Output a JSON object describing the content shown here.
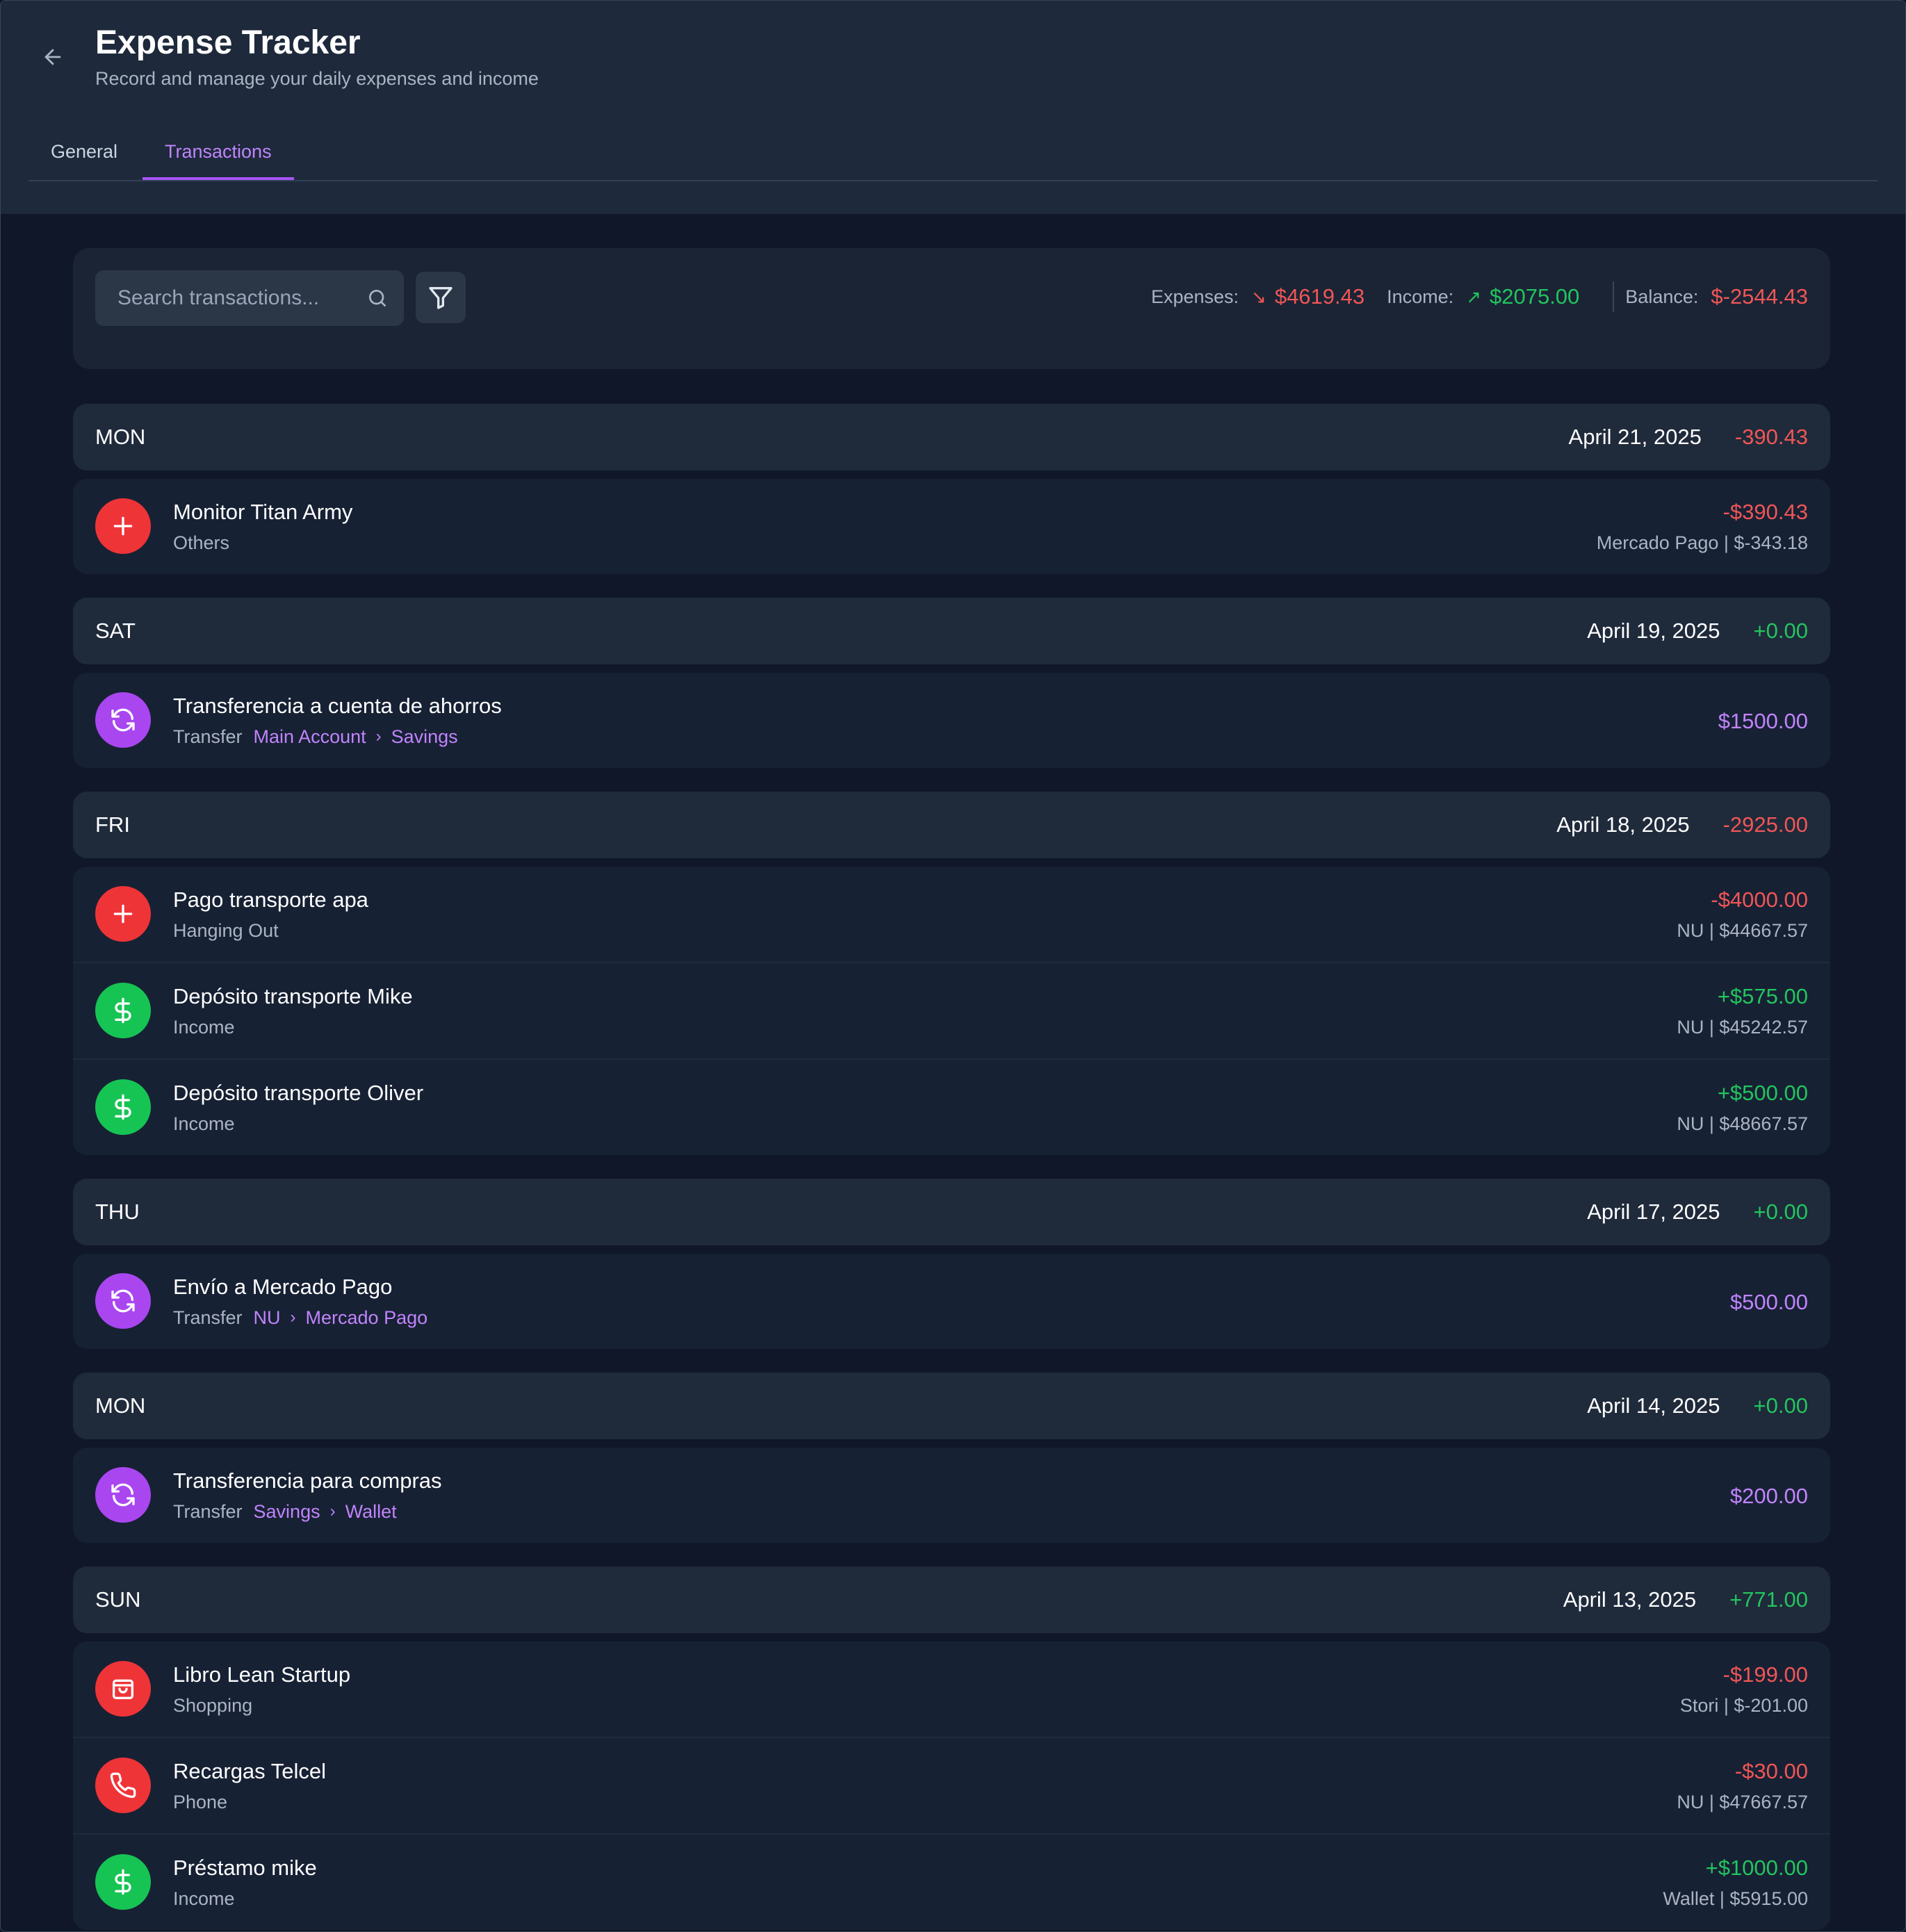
{
  "header": {
    "title": "Expense Tracker",
    "subtitle": "Record and manage your daily expenses and income",
    "tabs": [
      {
        "label": "General",
        "active": false
      },
      {
        "label": "Transactions",
        "active": true
      }
    ]
  },
  "toolbar": {
    "search_placeholder": "Search transactions...",
    "expenses_label": "Expenses:",
    "expenses_value": "$4619.43",
    "income_label": "Income:",
    "income_value": "$2075.00",
    "balance_label": "Balance:",
    "balance_value": "$-2544.43"
  },
  "colors": {
    "expense": "#f05656",
    "income": "#22c55e",
    "transfer": "#c084fc",
    "accent": "#a855f7"
  },
  "groups": [
    {
      "day": "MON",
      "date": "April 21, 2025",
      "total": "-390.43",
      "total_kind": "expense",
      "transactions": [
        {
          "name": "Monitor Titan Army",
          "category": "Others",
          "kind": "expense",
          "icon": "plus-icon",
          "amount": "-$390.43",
          "account": "Mercado Pago | $-343.18"
        }
      ]
    },
    {
      "day": "SAT",
      "date": "April 19, 2025",
      "total": "+0.00",
      "total_kind": "income",
      "transactions": [
        {
          "name": "Transferencia a cuenta de ahorros",
          "category": "Transfer",
          "kind": "transfer",
          "icon": "refresh-icon",
          "amount": "$1500.00",
          "from": "Main Account",
          "to": "Savings"
        }
      ]
    },
    {
      "day": "FRI",
      "date": "April 18, 2025",
      "total": "-2925.00",
      "total_kind": "expense",
      "transactions": [
        {
          "name": "Pago transporte apa",
          "category": "Hanging Out",
          "kind": "expense",
          "icon": "plus-icon",
          "amount": "-$4000.00",
          "account": "NU | $44667.57"
        },
        {
          "name": "Depósito transporte Mike",
          "category": "Income",
          "kind": "income",
          "icon": "dollar-icon",
          "amount": "+$575.00",
          "account": "NU | $45242.57"
        },
        {
          "name": "Depósito transporte Oliver",
          "category": "Income",
          "kind": "income",
          "icon": "dollar-icon",
          "amount": "+$500.00",
          "account": "NU | $48667.57"
        }
      ]
    },
    {
      "day": "THU",
      "date": "April 17, 2025",
      "total": "+0.00",
      "total_kind": "income",
      "transactions": [
        {
          "name": "Envío a Mercado Pago",
          "category": "Transfer",
          "kind": "transfer",
          "icon": "refresh-icon",
          "amount": "$500.00",
          "from": "NU",
          "to": "Mercado Pago"
        }
      ]
    },
    {
      "day": "MON",
      "date": "April 14, 2025",
      "total": "+0.00",
      "total_kind": "income",
      "transactions": [
        {
          "name": "Transferencia para compras",
          "category": "Transfer",
          "kind": "transfer",
          "icon": "refresh-icon",
          "amount": "$200.00",
          "from": "Savings",
          "to": "Wallet"
        }
      ]
    },
    {
      "day": "SUN",
      "date": "April 13, 2025",
      "total": "+771.00",
      "total_kind": "income",
      "transactions": [
        {
          "name": "Libro Lean Startup",
          "category": "Shopping",
          "kind": "expense",
          "icon": "shopping-bag-icon",
          "amount": "-$199.00",
          "account": "Stori | $-201.00"
        },
        {
          "name": "Recargas Telcel",
          "category": "Phone",
          "kind": "expense",
          "icon": "phone-icon",
          "amount": "-$30.00",
          "account": "NU | $47667.57"
        },
        {
          "name": "Préstamo mike",
          "category": "Income",
          "kind": "income",
          "icon": "dollar-icon",
          "amount": "+$1000.00",
          "account": "Wallet | $5915.00"
        }
      ]
    }
  ]
}
